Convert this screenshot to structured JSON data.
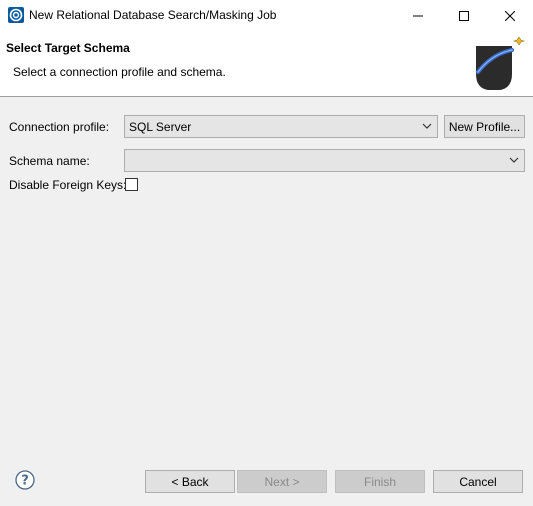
{
  "window": {
    "title": "New Relational Database Search/Masking Job"
  },
  "header": {
    "title": "Select Target Schema",
    "description": "Select a connection profile and schema."
  },
  "form": {
    "connection_profile_label": "Connection profile:",
    "connection_profile_value": "SQL Server",
    "new_profile_label": "New Profile...",
    "schema_name_label": "Schema name:",
    "schema_name_value": "",
    "disable_fk_label": "Disable Foreign Keys:",
    "disable_fk_checked": false
  },
  "footer": {
    "back_label": "< Back",
    "next_label": "Next >",
    "finish_label": "Finish",
    "cancel_label": "Cancel"
  },
  "icons": {
    "app": "app-logo-icon",
    "help": "help-icon",
    "wizard": "wizard-banner-icon"
  },
  "colors": {
    "accent": "#0a5a9c",
    "disabled_text": "#8a8a8a"
  }
}
